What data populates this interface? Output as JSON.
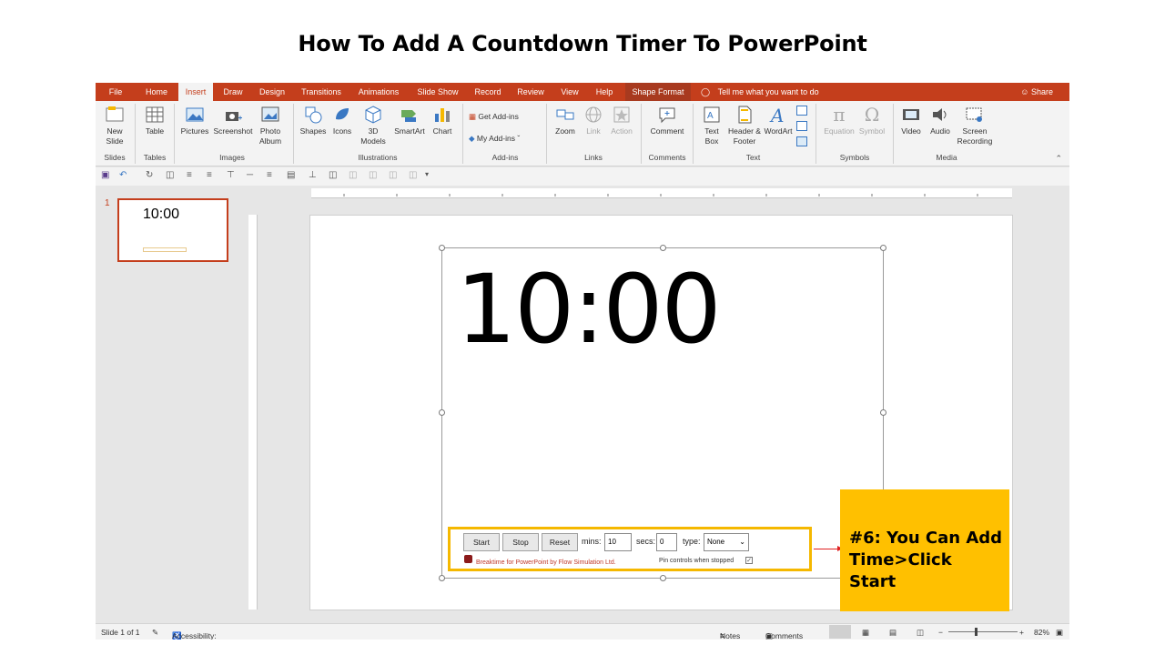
{
  "heading": "How To Add A Countdown Timer To PowerPoint",
  "tabs": [
    "File",
    "Home",
    "Insert",
    "Draw",
    "Design",
    "Transitions",
    "Animations",
    "Slide Show",
    "Record",
    "Review",
    "View",
    "Help",
    "Shape Format"
  ],
  "tell_me": "Tell me what you want to do",
  "share": "Share",
  "ribbon": {
    "new_slide": "New Slide",
    "table": "Table",
    "pictures": "Pictures",
    "screenshot": "Screenshot",
    "photo_album": "Photo Album",
    "shapes": "Shapes",
    "icons": "Icons",
    "models_3d": "3D Models",
    "smartart": "SmartArt",
    "chart": "Chart",
    "get_addins": "Get Add-ins",
    "my_addins": "My Add-ins",
    "zoom": "Zoom",
    "link": "Link",
    "action": "Action",
    "comment": "Comment",
    "text_box": "Text Box",
    "header_footer": "Header & Footer",
    "wordart": "WordArt",
    "equation": "Equation",
    "symbol": "Symbol",
    "video": "Video",
    "audio": "Audio",
    "screen_recording": "Screen Recording",
    "groups": {
      "slides": "Slides",
      "tables": "Tables",
      "images": "Images",
      "illustrations": "Illustrations",
      "addins": "Add-ins",
      "links": "Links",
      "comments": "Comments",
      "text": "Text",
      "symbols": "Symbols",
      "media": "Media"
    }
  },
  "thumbnail": {
    "number": "1",
    "text": "10:00"
  },
  "slide": {
    "timer": "10:00",
    "controls": {
      "start": "Start",
      "stop": "Stop",
      "reset": "Reset",
      "mins_label": "mins:",
      "mins_value": "10",
      "secs_label": "secs:",
      "secs_value": "0",
      "type_label": "type:",
      "type_value": "None",
      "credit": "Breaktime for PowerPoint by Flow Simulation Ltd.",
      "pin_label": "Pin controls when stopped"
    },
    "callout": "#6: You Can Add Time>Click Start"
  },
  "status": {
    "slide_count": "Slide 1 of 1",
    "accessibility": "Accessibility: Investigate",
    "notes": "Notes",
    "comments": "Comments",
    "zoom": "82%"
  },
  "colors": {
    "accent": "#c43e1c",
    "callout": "#ffc000",
    "arrow": "#e02020"
  }
}
